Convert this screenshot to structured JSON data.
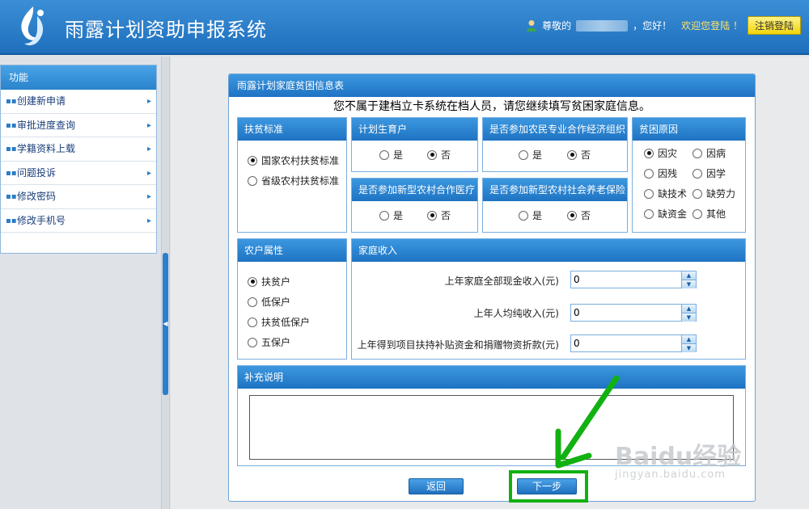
{
  "header": {
    "app_title": "雨露计划资助申报系统",
    "greeting_prefix": "尊敬的",
    "greeting_suffix": "，您好！",
    "welcome_text": "欢迎您登陆 ！",
    "logout_label": "注销登陆"
  },
  "sidebar": {
    "title": "功能",
    "items": [
      {
        "label": "创建新申请"
      },
      {
        "label": "审批进度查询"
      },
      {
        "label": "学籍资料上载"
      },
      {
        "label": "问题投诉"
      },
      {
        "label": "修改密码"
      },
      {
        "label": "修改手机号"
      }
    ]
  },
  "panel": {
    "title": "雨露计划家庭贫困信息表",
    "notice": "您不属于建档立卡系统在档人员，请您继续填写贫困家庭信息。"
  },
  "poverty_standard": {
    "title": "扶贫标准",
    "options": [
      {
        "label": "国家农村扶贫标准",
        "checked": true
      },
      {
        "label": "省级农村扶贫标准",
        "checked": false
      }
    ]
  },
  "family_planning": {
    "title": "计划生育户",
    "options": [
      {
        "label": "是",
        "checked": false
      },
      {
        "label": "否",
        "checked": true
      }
    ]
  },
  "coop": {
    "title": "是否参加农民专业合作经济组织",
    "options": [
      {
        "label": "是",
        "checked": false
      },
      {
        "label": "否",
        "checked": true
      }
    ]
  },
  "rural_medical": {
    "title": "是否参加新型农村合作医疗",
    "options": [
      {
        "label": "是",
        "checked": false
      },
      {
        "label": "否",
        "checked": true
      }
    ]
  },
  "rural_pension": {
    "title": "是否参加新型农村社会养老保险",
    "options": [
      {
        "label": "是",
        "checked": false
      },
      {
        "label": "否",
        "checked": true
      }
    ]
  },
  "poverty_cause": {
    "title": "贫困原因",
    "options": [
      {
        "label": "因灾",
        "checked": true
      },
      {
        "label": "因病",
        "checked": false
      },
      {
        "label": "因残",
        "checked": false
      },
      {
        "label": "因学",
        "checked": false
      },
      {
        "label": "缺技术",
        "checked": false
      },
      {
        "label": "缺劳力",
        "checked": false
      },
      {
        "label": "缺资金",
        "checked": false
      },
      {
        "label": "其他",
        "checked": false
      }
    ]
  },
  "household_type": {
    "title": "农户属性",
    "options": [
      {
        "label": "扶贫户",
        "checked": true
      },
      {
        "label": "低保户",
        "checked": false
      },
      {
        "label": "扶贫低保户",
        "checked": false
      },
      {
        "label": "五保户",
        "checked": false
      }
    ]
  },
  "income": {
    "title": "家庭收入",
    "fields": [
      {
        "label": "上年家庭全部现金收入(元)",
        "value": "0"
      },
      {
        "label": "上年人均纯收入(元)",
        "value": "0"
      },
      {
        "label": "上年得到项目扶持补贴资金和捐赠物资折款(元)",
        "value": "0"
      }
    ]
  },
  "remark": {
    "title": "补充说明",
    "value": ""
  },
  "actions": {
    "back_label": "返回",
    "next_label": "下一步"
  },
  "watermark": {
    "brand": "Baidu经验",
    "url": "jingyan.baidu.com"
  },
  "colors": {
    "header_blue": "#1f6fbd",
    "highlight_green": "#12b112",
    "logout_yellow": "#f2d40a"
  }
}
